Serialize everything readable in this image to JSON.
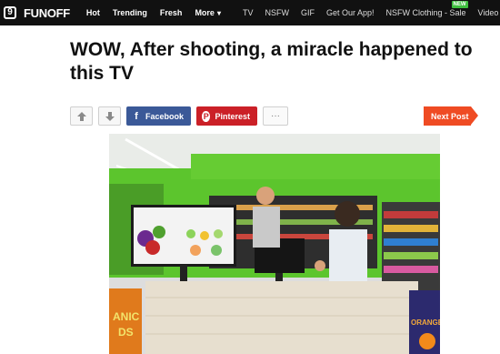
{
  "site": {
    "logo_mark": "9",
    "logo_text": "FUNOFF"
  },
  "nav": {
    "primary": [
      "Hot",
      "Trending",
      "Fresh",
      "More"
    ],
    "secondary": [
      "TV",
      "NSFW",
      "GIF",
      "Get Our App!",
      "NSFW Clothing - Sale",
      "Video"
    ],
    "new_badge": "NEW"
  },
  "article": {
    "title": "WOW, After shooting, a miracle happened to this TV",
    "share": {
      "upvote_icon": "arrow-up-icon",
      "downvote_icon": "arrow-down-icon",
      "facebook_label": "Facebook",
      "pinterest_label": "Pinterest",
      "more_label": "···",
      "next_label": "Next Post"
    },
    "image_signs": {
      "left": "ANIC\nDS",
      "right": "ORANGE"
    }
  },
  "colors": {
    "topbar": "#111111",
    "facebook": "#3b5998",
    "pinterest": "#cb2027",
    "next": "#ef4b23",
    "wall_green": "#5cc52d"
  }
}
